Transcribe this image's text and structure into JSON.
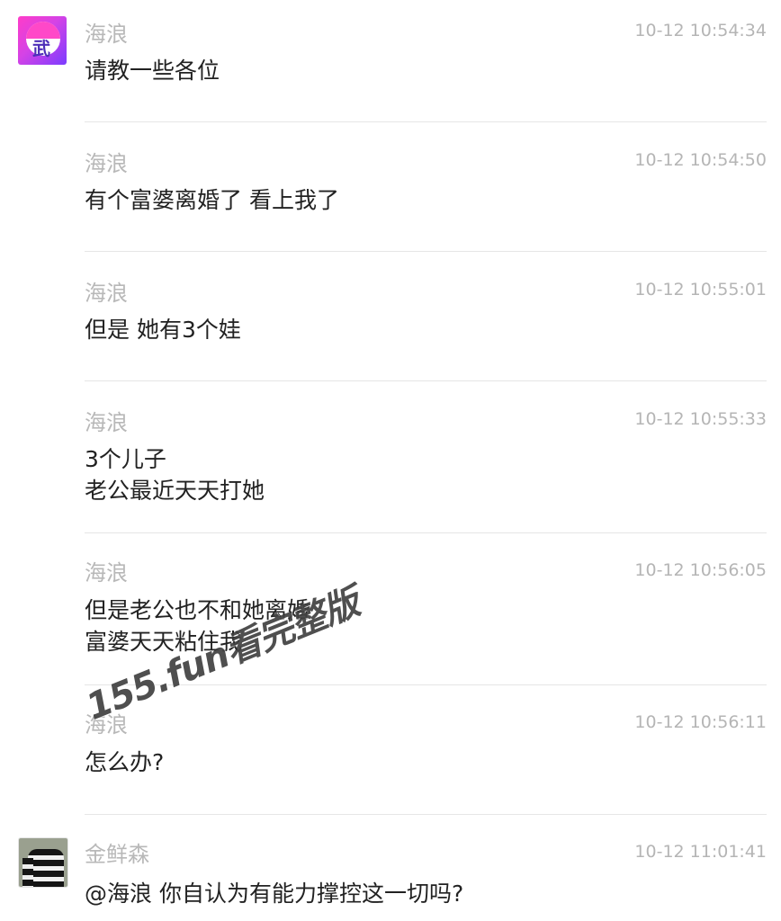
{
  "messages": [
    {
      "sender": "海浪",
      "time": "10-12 10:54:34",
      "lines": [
        "请教一些各位"
      ]
    },
    {
      "sender": "海浪",
      "time": "10-12 10:54:50",
      "lines": [
        "有个富婆离婚了   看上我了"
      ]
    },
    {
      "sender": "海浪",
      "time": "10-12 10:55:01",
      "lines": [
        "但是 她有3个娃"
      ]
    },
    {
      "sender": "海浪",
      "time": "10-12 10:55:33",
      "lines": [
        "3个儿子",
        "老公最近天天打她"
      ]
    },
    {
      "sender": "海浪",
      "time": "10-12 10:56:05",
      "lines": [
        "但是老公也不和她离婚",
        "富婆天天粘住我"
      ]
    },
    {
      "sender": "海浪",
      "time": "10-12 10:56:11",
      "lines": [
        "怎么办?"
      ]
    },
    {
      "sender": "金鲜森",
      "time": "10-12 11:01:41",
      "lines": [
        "@海浪 你自认为有能力撑控这一切吗?"
      ]
    }
  ],
  "avatars": {
    "hailang": {
      "icon": "yin-yang-avatar-icon",
      "glyph": "武",
      "colors": [
        "#ff3cc8",
        "#7b3cff"
      ]
    },
    "jin": {
      "icon": "striped-shirt-avatar-icon"
    }
  },
  "watermark": {
    "text": "155.fun看完整版"
  }
}
